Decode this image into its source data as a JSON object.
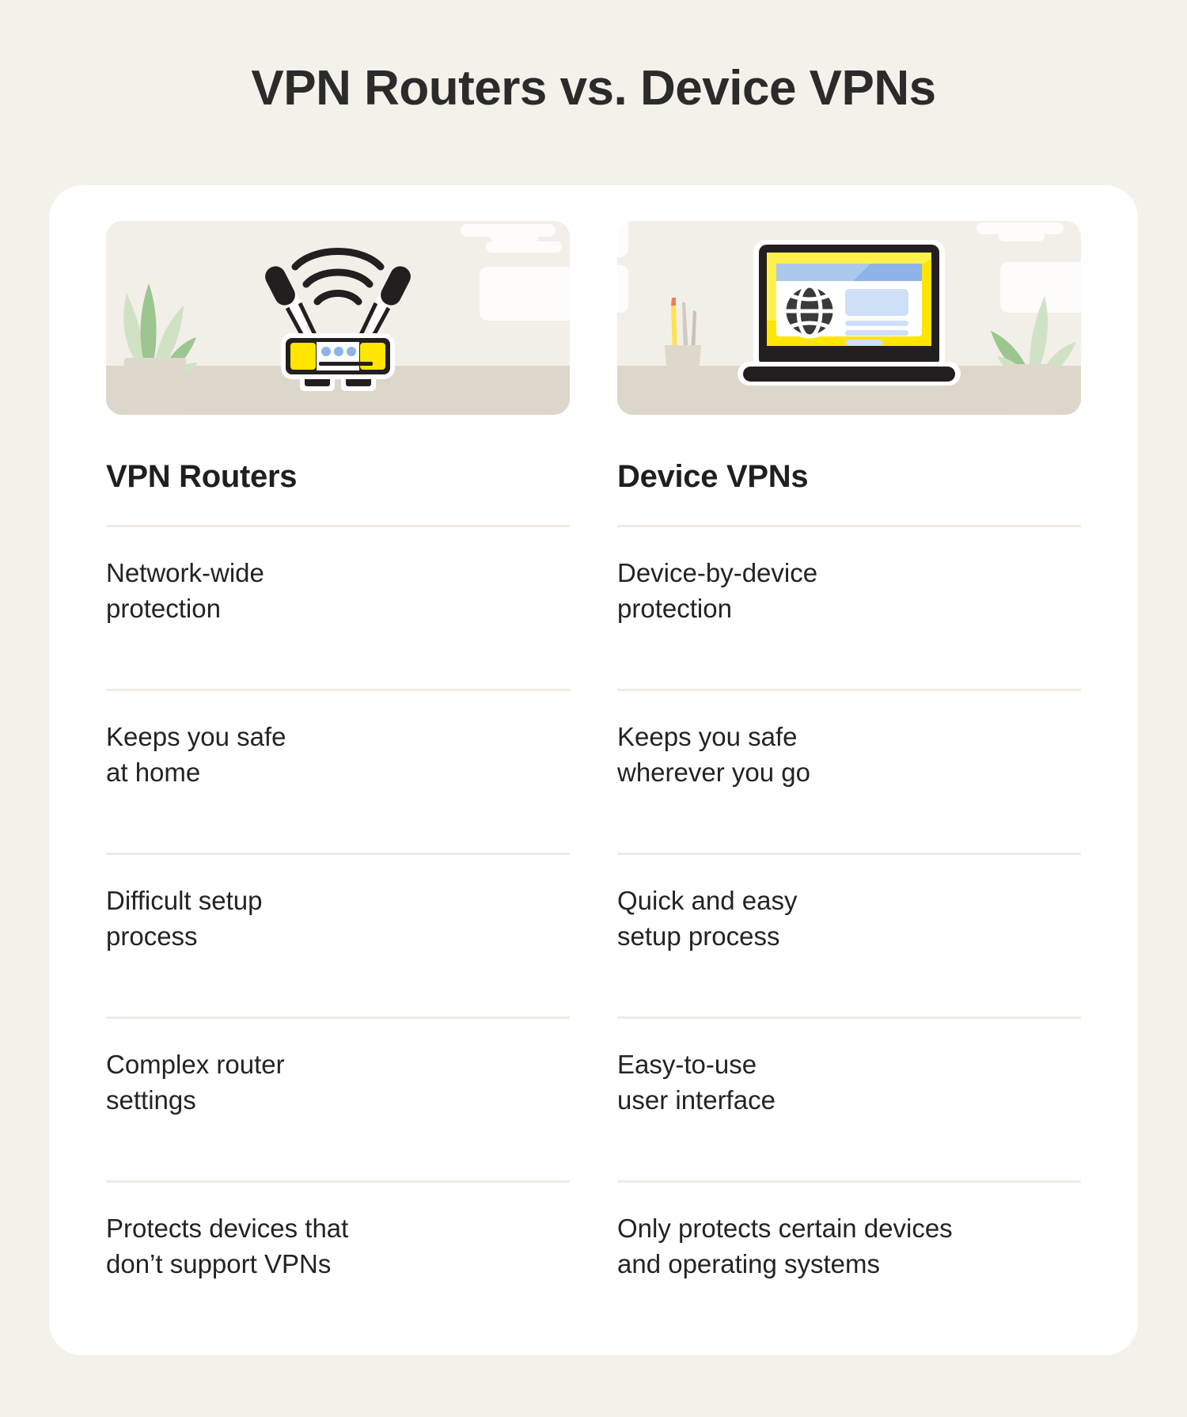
{
  "title": "VPN Routers vs. Device VPNs",
  "theme": {
    "page_background": "#f4f1ea",
    "card_background": "#ffffff",
    "panel_background": "#f2efe9",
    "desk": "#ddd6ca",
    "accent_yellow": "#ffe500",
    "accent_blue": "#8db3e8",
    "ink": "#232323",
    "divider": "#efebe3",
    "leaf_light": "#cfe3c4",
    "leaf_dark": "#9cc68f"
  },
  "columns": [
    {
      "key": "vpn_routers",
      "heading": "VPN Routers",
      "illustration": "wifi-router-illustration",
      "items": [
        "Network-wide\nprotection",
        "Keeps you safe\nat home",
        "Difficult setup\nprocess",
        "Complex router\nsettings",
        "Protects devices that\ndon’t support VPNs"
      ]
    },
    {
      "key": "device_vpns",
      "heading": "Device VPNs",
      "illustration": "laptop-browser-illustration",
      "items": [
        "Device-by-device\nprotection",
        "Keeps you safe\nwherever you go",
        "Quick and easy\nsetup process",
        "Easy-to-use\nuser interface",
        "Only protects certain devices\nand operating systems"
      ]
    }
  ]
}
